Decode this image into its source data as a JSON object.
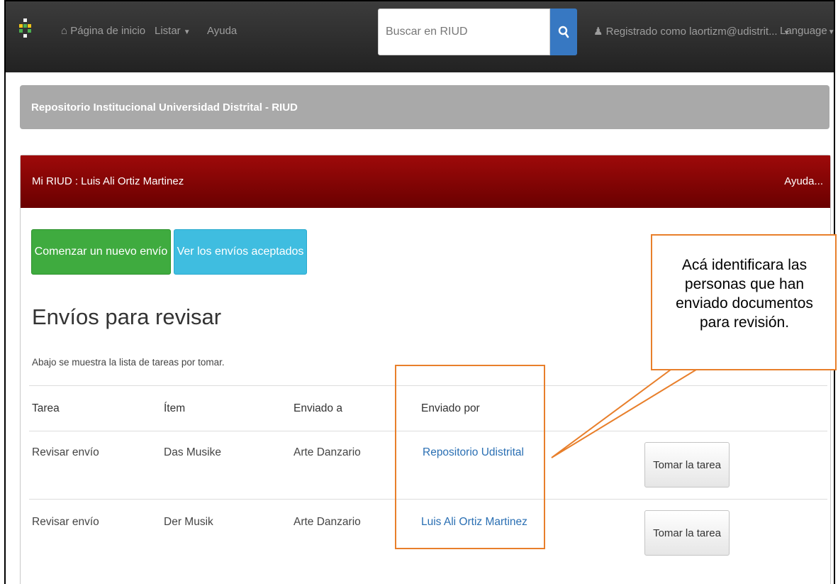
{
  "navbar": {
    "home_label": "Página de inicio",
    "browse_label": "Listar",
    "help_label": "Ayuda",
    "search_placeholder": "Buscar en RIUD",
    "user_label": "Registrado como laortizm@udistrit...",
    "language_label": "Language"
  },
  "breadcrumb": {
    "title": "Repositorio Institucional Universidad Distrital - RIUD"
  },
  "panel": {
    "title": "Mi RIUD : Luis Ali Ortiz Martinez",
    "help_label": "Ayuda...",
    "new_submission_label": "Comenzar un nuevo envío",
    "accepted_submissions_label": "Ver los envíos aceptados"
  },
  "review": {
    "title": "Envíos para revisar",
    "subtitle": "Abajo se muestra la lista de tareas por tomar.",
    "headers": [
      "Tarea",
      "Ítem",
      "Enviado a",
      "Enviado por"
    ],
    "rows": [
      {
        "task": "Revisar envío",
        "item": "Das Musike",
        "sent_to": "Arte Danzario",
        "sent_by": "Repositorio Udistrital",
        "action": "Tomar la tarea"
      },
      {
        "task": "Revisar envío",
        "item": "Der Musik",
        "sent_to": "Arte Danzario",
        "sent_by": "Luis Ali Ortiz Martinez",
        "action": "Tomar la tarea"
      }
    ]
  },
  "annotation": {
    "text": "Acá identificara las personas que han enviado documentos para revisión.",
    "color": "#e87f2b"
  },
  "colors": {
    "navbar": "#222222",
    "panel_header": "#8b0000",
    "green_button": "#3fab3f",
    "blue_button": "#3fbde0",
    "search_button": "#3778c2",
    "link": "#2a6fb3"
  }
}
